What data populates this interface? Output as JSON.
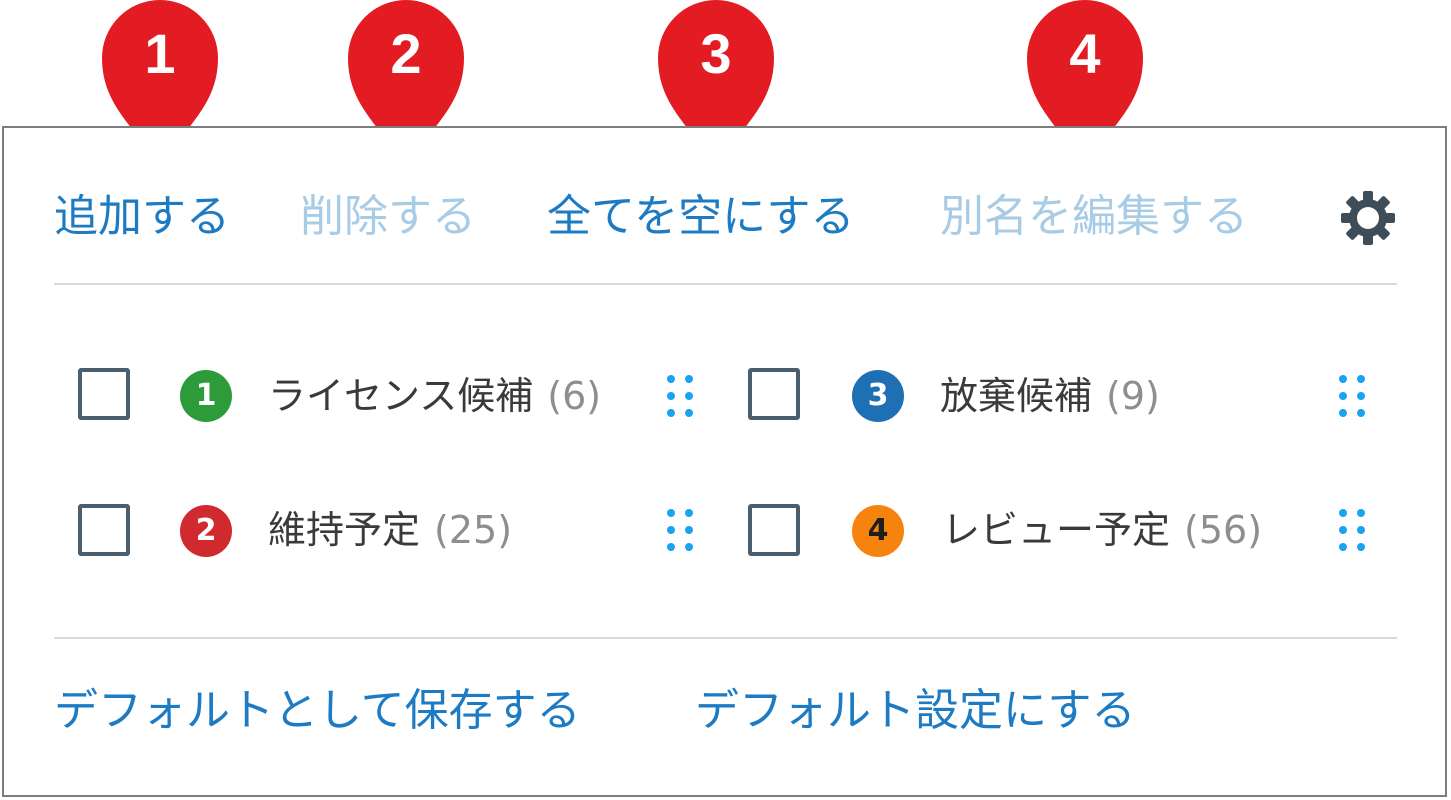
{
  "markers": [
    {
      "number": "1",
      "color": "#e31c23"
    },
    {
      "number": "2",
      "color": "#e31c23"
    },
    {
      "number": "3",
      "color": "#e31c23"
    },
    {
      "number": "4",
      "color": "#e31c23"
    }
  ],
  "toolbar": {
    "add_label": "追加する",
    "delete_label": "削除する",
    "clear_all_label": "全てを空にする",
    "edit_alias_label": "別名を編集する",
    "settings_icon": "gear-icon"
  },
  "tags": [
    {
      "badge": "1",
      "badge_color": "#2e9b3a",
      "badge_text_color": "#ffffff",
      "name": "ライセンス候補",
      "count": "(6)",
      "checked": false
    },
    {
      "badge": "3",
      "badge_color": "#1f6fb5",
      "badge_text_color": "#ffffff",
      "name": "放棄候補",
      "count": "(9)",
      "checked": false
    },
    {
      "badge": "2",
      "badge_color": "#d12a2e",
      "badge_text_color": "#ffffff",
      "name": "維持予定",
      "count": "(25)",
      "checked": false
    },
    {
      "badge": "4",
      "badge_color": "#f7830f",
      "badge_text_color": "#1e1e1e",
      "name": "レビュー予定",
      "count": "(56)",
      "checked": false
    }
  ],
  "footer": {
    "save_default_label": "デフォルトとして保存する",
    "set_default_label": "デフォルト設定にする"
  },
  "colors": {
    "link": "#1d7bc4",
    "link_disabled": "#a8cbe6",
    "drag_handle": "#1aa3f0",
    "checkbox_border": "#4a5e6e"
  }
}
